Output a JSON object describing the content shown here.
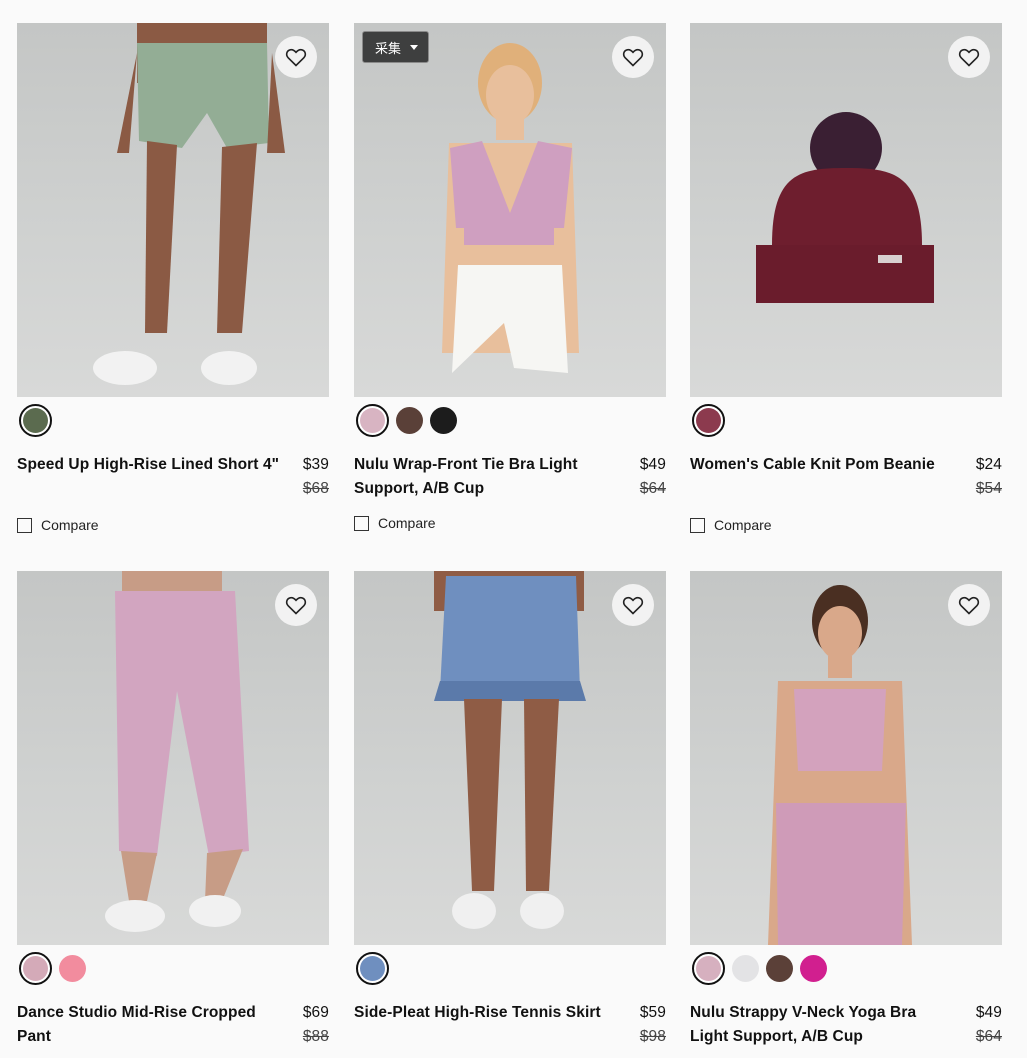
{
  "products": [
    {
      "name": "Speed Up High-Rise Lined Short 4\"",
      "price": "$39",
      "old_price": "$68",
      "compare_label": "Compare",
      "swatches": [
        "#5b6b4f"
      ],
      "icon": "heart-outline-icon"
    },
    {
      "name": "Nulu Wrap-Front Tie Bra Light Support, A/B Cup",
      "price": "$49",
      "old_price": "$64",
      "compare_label": "Compare",
      "swatches": [
        "#d8b4c2",
        "#5a4038",
        "#1c1c1c"
      ],
      "badge_label": "采集",
      "icon": "heart-outline-icon"
    },
    {
      "name": "Women's Cable Knit Pom Beanie",
      "price": "$24",
      "old_price": "$54",
      "compare_label": "Compare",
      "swatches": [
        "#8c3a4e"
      ],
      "icon": "heart-outline-icon"
    },
    {
      "name": "Dance Studio Mid-Rise Cropped Pant",
      "price": "$69",
      "old_price": "$88",
      "swatches": [
        "#d4aab8",
        "#f28c9e"
      ],
      "icon": "heart-outline-icon"
    },
    {
      "name": "Side-Pleat High-Rise Tennis Skirt",
      "price": "$59",
      "old_price": "$98",
      "swatches": [
        "#6f8fbf"
      ],
      "icon": "heart-outline-icon"
    },
    {
      "name": "Nulu Strappy V-Neck Yoga Bra Light Support, A/B Cup",
      "price": "$49",
      "old_price": "$64",
      "swatches": [
        "#d6b0bf",
        "#e3e3e5",
        "#5b4038",
        "#d11f8f"
      ],
      "icon": "heart-outline-icon"
    }
  ]
}
